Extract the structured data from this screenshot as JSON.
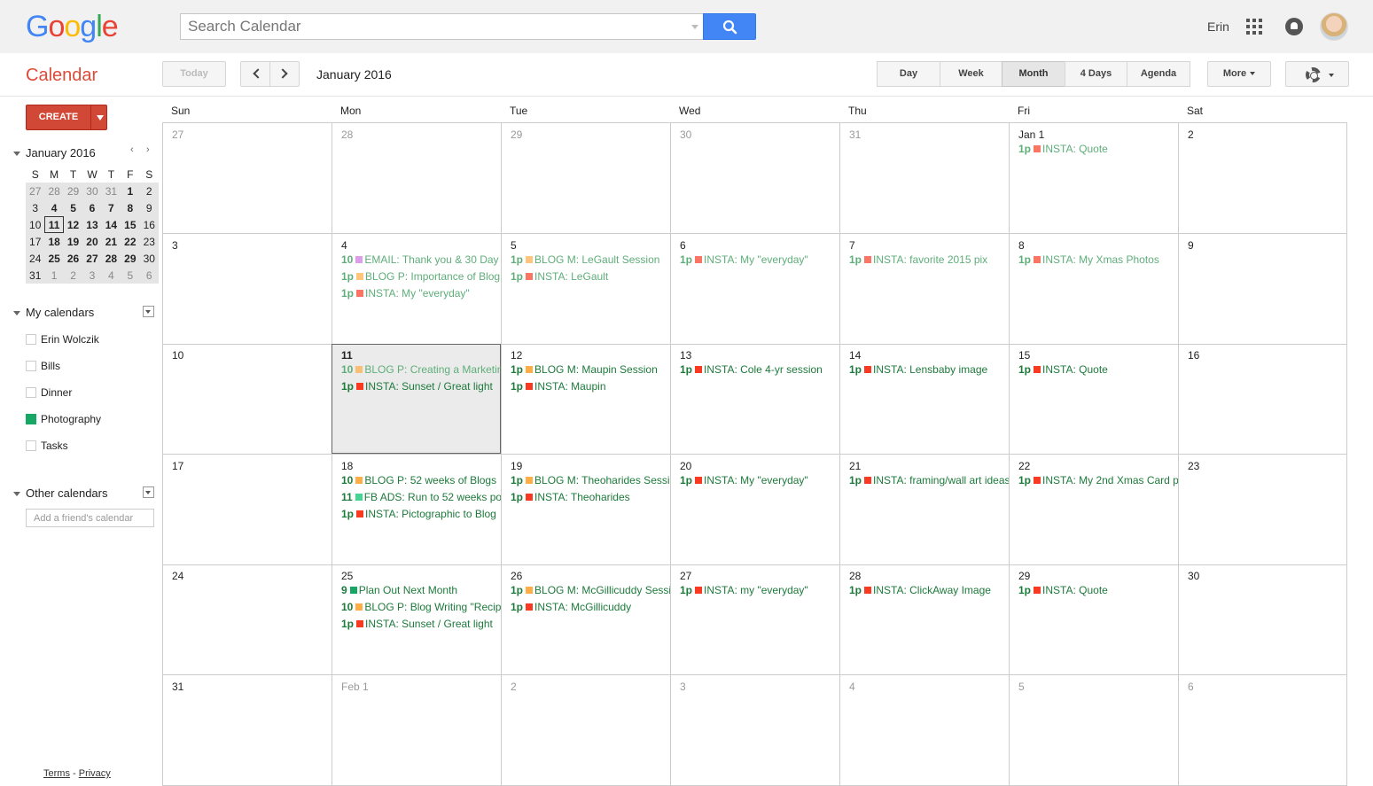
{
  "header": {
    "logo_letters": [
      {
        "ch": "G",
        "color": "#4285f4"
      },
      {
        "ch": "o",
        "color": "#ea4335"
      },
      {
        "ch": "o",
        "color": "#fbbc05"
      },
      {
        "ch": "g",
        "color": "#4285f4"
      },
      {
        "ch": "l",
        "color": "#34a853"
      },
      {
        "ch": "e",
        "color": "#ea4335"
      }
    ],
    "search_placeholder": "Search Calendar",
    "user_name": "Erin"
  },
  "appbar": {
    "title": "Calendar",
    "today_label": "Today",
    "date_range": "January 2016",
    "views": [
      {
        "label": "Day",
        "active": false
      },
      {
        "label": "Week",
        "active": false
      },
      {
        "label": "Month",
        "active": true
      },
      {
        "label": "4 Days",
        "active": false
      },
      {
        "label": "Agenda",
        "active": false
      }
    ],
    "more_label": "More"
  },
  "sidebar": {
    "create_label": "CREATE",
    "mini_title": "January 2016",
    "mini_prev": "‹",
    "mini_next": "›",
    "mini_headers": [
      "S",
      "M",
      "T",
      "W",
      "T",
      "F",
      "S"
    ],
    "mini_weeks": [
      [
        {
          "d": "27",
          "o": 1
        },
        {
          "d": "28",
          "o": 1
        },
        {
          "d": "29",
          "o": 1
        },
        {
          "d": "30",
          "o": 1
        },
        {
          "d": "31",
          "o": 1
        },
        {
          "d": "1",
          "b": 1
        },
        {
          "d": "2"
        }
      ],
      [
        {
          "d": "3"
        },
        {
          "d": "4",
          "b": 1
        },
        {
          "d": "5",
          "b": 1
        },
        {
          "d": "6",
          "b": 1
        },
        {
          "d": "7",
          "b": 1
        },
        {
          "d": "8",
          "b": 1
        },
        {
          "d": "9"
        }
      ],
      [
        {
          "d": "10"
        },
        {
          "d": "11",
          "today": 1
        },
        {
          "d": "12",
          "b": 1
        },
        {
          "d": "13",
          "b": 1
        },
        {
          "d": "14",
          "b": 1
        },
        {
          "d": "15",
          "b": 1
        },
        {
          "d": "16"
        }
      ],
      [
        {
          "d": "17"
        },
        {
          "d": "18",
          "b": 1
        },
        {
          "d": "19",
          "b": 1
        },
        {
          "d": "20",
          "b": 1
        },
        {
          "d": "21",
          "b": 1
        },
        {
          "d": "22",
          "b": 1
        },
        {
          "d": "23"
        }
      ],
      [
        {
          "d": "24"
        },
        {
          "d": "25",
          "b": 1
        },
        {
          "d": "26",
          "b": 1
        },
        {
          "d": "27",
          "b": 1
        },
        {
          "d": "28",
          "b": 1
        },
        {
          "d": "29",
          "b": 1
        },
        {
          "d": "30"
        }
      ],
      [
        {
          "d": "31"
        },
        {
          "d": "1",
          "o": 1
        },
        {
          "d": "2",
          "o": 1
        },
        {
          "d": "3",
          "o": 1
        },
        {
          "d": "4",
          "o": 1
        },
        {
          "d": "5",
          "o": 1
        },
        {
          "d": "6",
          "o": 1
        }
      ]
    ],
    "my_calendars_label": "My calendars",
    "my_calendars": [
      {
        "label": "Erin Wolczik",
        "color": "#ffffff",
        "checked": false
      },
      {
        "label": "Bills",
        "color": "#ffffff",
        "checked": false
      },
      {
        "label": "Dinner",
        "color": "#ffffff",
        "checked": false
      },
      {
        "label": "Photography",
        "color": "#16a765",
        "checked": true
      },
      {
        "label": "Tasks",
        "color": "#ffffff",
        "checked": false
      }
    ],
    "other_calendars_label": "Other calendars",
    "friend_placeholder": "Add a friend's calendar",
    "terms": "Terms",
    "separator": " - ",
    "privacy": "Privacy"
  },
  "month": {
    "weekdays": [
      "Sun",
      "Mon",
      "Tue",
      "Wed",
      "Thu",
      "Fri",
      "Sat"
    ],
    "event_colors": {
      "email": "#cd74e6",
      "blog": "#ffad46",
      "insta": "#f83a22",
      "fb": "#42d692",
      "plan": "#16a765"
    },
    "weeks": [
      [
        {
          "n": "27",
          "other": true
        },
        {
          "n": "28",
          "other": true
        },
        {
          "n": "29",
          "other": true
        },
        {
          "n": "30",
          "other": true
        },
        {
          "n": "31",
          "other": true
        },
        {
          "n": "Jan 1",
          "events": [
            {
              "t": "1p",
              "c": "insta",
              "s": "INSTA: Quote",
              "past": true
            }
          ]
        },
        {
          "n": "2"
        }
      ],
      [
        {
          "n": "3"
        },
        {
          "n": "4",
          "events": [
            {
              "t": "10",
              "c": "email",
              "s": "EMAIL: Thank you & 30 Day",
              "past": true
            },
            {
              "t": "1p",
              "c": "blog",
              "s": "BLOG P: Importance of Blog",
              "past": true
            },
            {
              "t": "1p",
              "c": "insta",
              "s": "INSTA: My \"everyday\"",
              "past": true
            }
          ]
        },
        {
          "n": "5",
          "events": [
            {
              "t": "1p",
              "c": "blog",
              "s": "BLOG M: LeGault Session",
              "past": true
            },
            {
              "t": "1p",
              "c": "insta",
              "s": "INSTA: LeGault",
              "past": true
            }
          ]
        },
        {
          "n": "6",
          "events": [
            {
              "t": "1p",
              "c": "insta",
              "s": "INSTA: My \"everyday\"",
              "past": true
            }
          ]
        },
        {
          "n": "7",
          "events": [
            {
              "t": "1p",
              "c": "insta",
              "s": "INSTA: favorite 2015 pix",
              "past": true
            }
          ]
        },
        {
          "n": "8",
          "events": [
            {
              "t": "1p",
              "c": "insta",
              "s": "INSTA: My Xmas Photos",
              "past": true
            }
          ]
        },
        {
          "n": "9"
        }
      ],
      [
        {
          "n": "10"
        },
        {
          "n": "11",
          "selected": true,
          "events": [
            {
              "t": "10",
              "c": "blog",
              "s": "BLOG P: Creating a Marketing",
              "past": true
            },
            {
              "t": "1p",
              "c": "insta",
              "s": "INSTA: Sunset / Great light"
            }
          ]
        },
        {
          "n": "12",
          "events": [
            {
              "t": "1p",
              "c": "blog",
              "s": "BLOG M: Maupin Session"
            },
            {
              "t": "1p",
              "c": "insta",
              "s": "INSTA: Maupin"
            }
          ]
        },
        {
          "n": "13",
          "events": [
            {
              "t": "1p",
              "c": "insta",
              "s": "INSTA: Cole 4-yr session"
            }
          ]
        },
        {
          "n": "14",
          "events": [
            {
              "t": "1p",
              "c": "insta",
              "s": "INSTA: Lensbaby image"
            }
          ]
        },
        {
          "n": "15",
          "events": [
            {
              "t": "1p",
              "c": "insta",
              "s": "INSTA: Quote"
            }
          ]
        },
        {
          "n": "16"
        }
      ],
      [
        {
          "n": "17"
        },
        {
          "n": "18",
          "events": [
            {
              "t": "10",
              "c": "blog",
              "s": "BLOG P: 52 weeks of Blogs"
            },
            {
              "t": "11",
              "c": "fb",
              "s": "FB ADS: Run to 52 weeks po"
            },
            {
              "t": "1p",
              "c": "insta",
              "s": "INSTA: Pictographic to Blog"
            }
          ]
        },
        {
          "n": "19",
          "events": [
            {
              "t": "1p",
              "c": "blog",
              "s": "BLOG M: Theoharides Session"
            },
            {
              "t": "1p",
              "c": "insta",
              "s": "INSTA: Theoharides"
            }
          ]
        },
        {
          "n": "20",
          "events": [
            {
              "t": "1p",
              "c": "insta",
              "s": "INSTA: My \"everyday\""
            }
          ]
        },
        {
          "n": "21",
          "events": [
            {
              "t": "1p",
              "c": "insta",
              "s": "INSTA: framing/wall art ideas"
            }
          ]
        },
        {
          "n": "22",
          "events": [
            {
              "t": "1p",
              "c": "insta",
              "s": "INSTA: My 2nd Xmas Card p"
            }
          ]
        },
        {
          "n": "23"
        }
      ],
      [
        {
          "n": "24"
        },
        {
          "n": "25",
          "events": [
            {
              "t": "9",
              "c": "plan",
              "s": "Plan Out Next Month"
            },
            {
              "t": "10",
              "c": "blog",
              "s": "BLOG P: Blog Writing \"Recipe"
            },
            {
              "t": "1p",
              "c": "insta",
              "s": "INSTA: Sunset / Great light"
            }
          ]
        },
        {
          "n": "26",
          "events": [
            {
              "t": "1p",
              "c": "blog",
              "s": "BLOG M: McGillicuddy Session"
            },
            {
              "t": "1p",
              "c": "insta",
              "s": "INSTA: McGillicuddy"
            }
          ]
        },
        {
          "n": "27",
          "events": [
            {
              "t": "1p",
              "c": "insta",
              "s": "INSTA: my \"everyday\""
            }
          ]
        },
        {
          "n": "28",
          "events": [
            {
              "t": "1p",
              "c": "insta",
              "s": "INSTA: ClickAway Image"
            }
          ]
        },
        {
          "n": "29",
          "events": [
            {
              "t": "1p",
              "c": "insta",
              "s": "INSTA: Quote"
            }
          ]
        },
        {
          "n": "30"
        }
      ],
      [
        {
          "n": "31"
        },
        {
          "n": "Feb 1",
          "other": true
        },
        {
          "n": "2",
          "other": true
        },
        {
          "n": "3",
          "other": true
        },
        {
          "n": "4",
          "other": true
        },
        {
          "n": "5",
          "other": true
        },
        {
          "n": "6",
          "other": true
        }
      ]
    ]
  }
}
